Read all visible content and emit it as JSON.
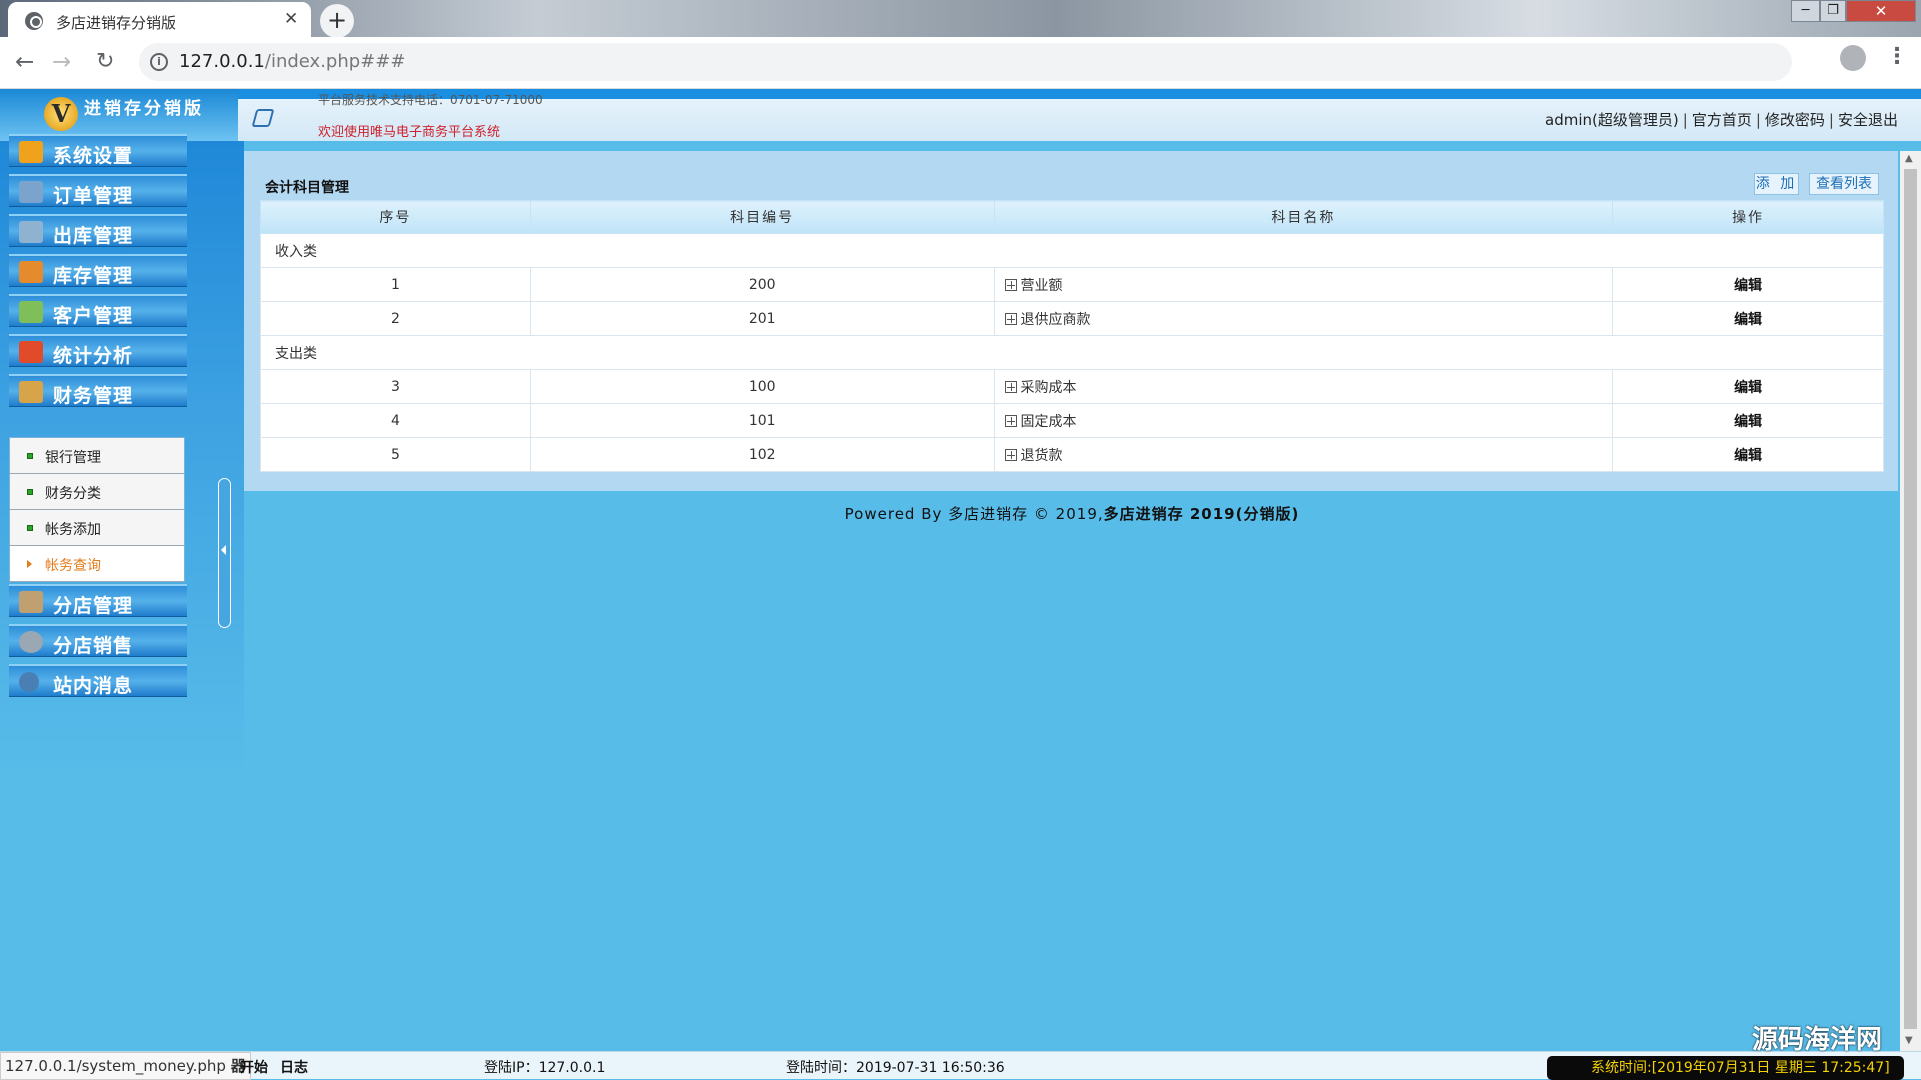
{
  "browser": {
    "tab_title": "多店进销存分销版",
    "url_host": "127.0.0.1",
    "url_path": "/index.php###",
    "tab_close": "✕",
    "newtab": "+"
  },
  "header": {
    "logo_letter": "V",
    "logo_text": "进销存分销版",
    "line1": "平台服务技术支持电话：0701-07-71000",
    "line2": "欢迎使用唯马电子商务平台系统",
    "links": [
      "admin(超级管理员)",
      "官方首页",
      "修改密码",
      "安全退出"
    ]
  },
  "sidebar": {
    "categories": [
      {
        "label": "系统设置",
        "icon": "wrench-icon",
        "color": "#f0a21d"
      },
      {
        "label": "订单管理",
        "icon": "order-icon",
        "color": "#7aa4cc"
      },
      {
        "label": "出库管理",
        "icon": "outbound-icon",
        "color": "#8fb2d0"
      },
      {
        "label": "库存管理",
        "icon": "inventory-icon",
        "color": "#e48b2d"
      },
      {
        "label": "客户管理",
        "icon": "customer-icon",
        "color": "#7fbf5a"
      },
      {
        "label": "统计分析",
        "icon": "bar-chart-icon",
        "color": "#e24b2a"
      },
      {
        "label": "财务管理",
        "icon": "finance-icon",
        "color": "#d8a44a"
      },
      {
        "label": "分店管理",
        "icon": "branch-icon",
        "color": "#c0a070"
      },
      {
        "label": "分店销售",
        "icon": "gear-icon",
        "color": "#9aa8b4"
      },
      {
        "label": "站内消息",
        "icon": "info-icon",
        "color": "#4a7fb4"
      }
    ],
    "finance_submenu": [
      "银行管理",
      "财务分类",
      "帐务添加",
      "帐务查询"
    ]
  },
  "main": {
    "title": "会计科目管理",
    "btn_add": "添 加",
    "btn_list": "查看列表",
    "columns": [
      "序号",
      "科目编号",
      "科目名称",
      "操作"
    ],
    "groups": [
      {
        "name": "收入类",
        "rows": [
          {
            "seq": "1",
            "code": "200",
            "name": "营业额",
            "op": "编辑"
          },
          {
            "seq": "2",
            "code": "201",
            "name": "退供应商款",
            "op": "编辑"
          }
        ]
      },
      {
        "name": "支出类",
        "rows": [
          {
            "seq": "3",
            "code": "100",
            "name": "采购成本",
            "op": "编辑"
          },
          {
            "seq": "4",
            "code": "101",
            "name": "固定成本",
            "op": "编辑"
          },
          {
            "seq": "5",
            "code": "102",
            "name": "退货款",
            "op": "编辑"
          }
        ]
      }
    ],
    "footer_prefix": "Powered By 多店进销存 © 2019,",
    "footer_bold": "多店进销存 2019(分销版)"
  },
  "statusbar": {
    "url": "127.0.0.1/system_money.php",
    "glyph": "器",
    "start": "开始",
    "log": "日志",
    "ip": "登陆IP：127.0.0.1",
    "time": "登陆时间：2019-07-31 16:50:36",
    "systime": "系统时间:[2019年07月31日 星期三 17:25:47]",
    "watermark": "源码海洋网"
  }
}
